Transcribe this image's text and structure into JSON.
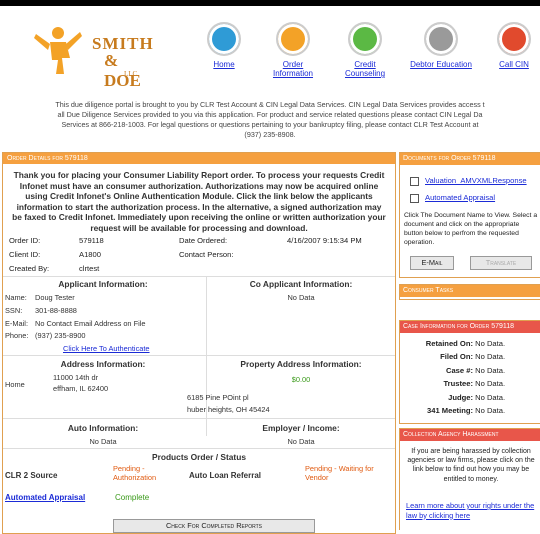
{
  "header": {
    "logo": {
      "line1": "SMITH",
      "line2": "& DOE",
      "line3": "LLC"
    },
    "nav": [
      {
        "label": "Home",
        "icon": "home-icon",
        "color": "#2f9bd6"
      },
      {
        "label": "Order Information",
        "icon": "person-icon",
        "color": "#f3a227"
      },
      {
        "label": "Credit Counseling",
        "icon": "document-icon",
        "color": "#5bb944"
      },
      {
        "label": "Debtor Education",
        "icon": "pen-icon",
        "color": "#9a9a9a"
      },
      {
        "label": "Call CIN",
        "icon": "phone-icon",
        "color": "#e14a2d"
      }
    ]
  },
  "intro": {
    "line1": "This due diligence portal is brought to you by CLR Test Account & CIN Legal Data Services. CIN Legal Data Services provides access t",
    "line2": "all Due Diligence Services provided to you via this application. For product and service related questions please contact CIN Legal Da",
    "line3": "Services at 866-218-1003. For legal questions or questions pertaining to your bankruptcy filing, please contact CLR Test Account at",
    "line4": "(937) 235-8908."
  },
  "order": {
    "header": "Order Details for 579118",
    "message": "Thank you for placing your Consumer Liability Report order. To process your requests Credit Infonet must have an consumer authorization. Authorizations may now be acquired online using Credit Infonet's Online Authentication Module. Click the link below the applicants information to start the authorization process. In the alternative, a signed authorization may be faxed to Credit Infonet. Immediately upon receiving the online or written authorization your request will be available for processing and download.",
    "order_id_label": "Order ID:",
    "order_id": "579118",
    "client_id_label": "Client ID:",
    "client_id": "A1800",
    "created_by_label": "Created By:",
    "created_by": "clrtest",
    "date_ordered_label": "Date Ordered:",
    "date_ordered": "4/16/2007 9:15:34 PM",
    "contact_label": "Contact Person:",
    "contact": ""
  },
  "applicant": {
    "title": "Applicant Information:",
    "name_label": "Name:",
    "name": "Doug Tester",
    "ssn_label": "SSN:",
    "ssn": "301-88-8888",
    "email_label": "E-Mail:",
    "email": "No Contact Email Address on File",
    "phone_label": "Phone:",
    "phone": "(937) 235-8900",
    "auth_link": "Click Here To Authenticate"
  },
  "co_applicant": {
    "title": "Co Applicant Information:",
    "value": "No Data"
  },
  "address": {
    "title": "Address Information:",
    "type": "Home",
    "line1": "11000 14th dr",
    "line2": "effham, IL 62400"
  },
  "property": {
    "title": "Property Address Information:",
    "value": "$0.00",
    "line1": "6185 Pine POint pl",
    "line2": "huber heights, OH 45424"
  },
  "auto": {
    "title": "Auto Information:",
    "value": "No Data"
  },
  "employer": {
    "title": "Employer / Income:",
    "value": "No Data"
  },
  "products": {
    "title": "Products Order / Status",
    "rows": [
      {
        "product": "CLR 2 Source",
        "status": "Pending - Authorization",
        "product2": "Auto Loan Referral",
        "status2": "Pending - Waiting for Vendor"
      },
      {
        "product": "Automated Appraisal",
        "status": "Complete"
      }
    ],
    "check_button": "Check For Completed Reports"
  },
  "documents": {
    "header": "Documents for Order 579118",
    "items": [
      "Valuation_AMVXMLResponse",
      "Automated Appraisal"
    ],
    "instructions": "Click The Document Name to View. Select a document and click on the appropriate button below to perfrom the requested operation.",
    "email_button": "E-Mail",
    "translate_button": "Translate"
  },
  "consumer_tasks": {
    "header": "Consumer Tasks"
  },
  "case_info": {
    "header": "Case Information for Order 579118",
    "rows": [
      {
        "label": "Retained On:",
        "value": "No Data."
      },
      {
        "label": "Filed On:",
        "value": "No Data."
      },
      {
        "label": "Case #:",
        "value": "No Data."
      },
      {
        "label": "Trustee:",
        "value": "No Data."
      },
      {
        "label": "Judge:",
        "value": "No Data."
      },
      {
        "label": "341 Meeting:",
        "value": "No Data."
      }
    ]
  },
  "collection": {
    "header": "Collection Agency Harassment",
    "text": "If you are being harassed by collection agencies or law firms, please click on the link below to find out how you may be entitled to money.",
    "link": "Learn more about your rights under the law by clicking here"
  }
}
